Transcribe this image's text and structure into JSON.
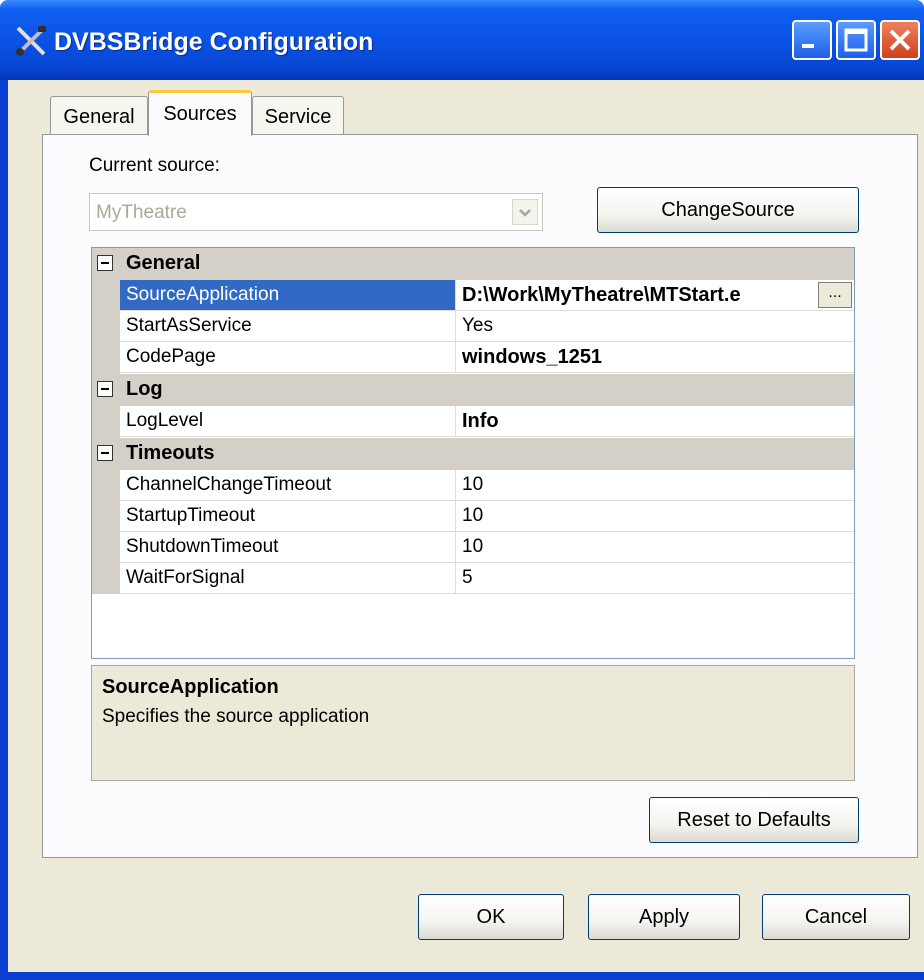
{
  "window": {
    "title": "DVBSBridge Configuration",
    "icons": {
      "app": "tools-icon",
      "minimize": "minimize-icon",
      "maximize": "maximize-icon",
      "close": "close-icon"
    }
  },
  "tabs": [
    {
      "label": "General",
      "active": false
    },
    {
      "label": "Sources",
      "active": true
    },
    {
      "label": "Service",
      "active": false
    }
  ],
  "sources": {
    "current_source_label": "Current source:",
    "current_source_value": "MyTheatre",
    "change_source_label": "ChangeSource"
  },
  "property_grid": {
    "categories": [
      {
        "name": "General",
        "properties": [
          {
            "name": "SourceApplication",
            "value": "D:\\Work\\MyTheatre\\MTStart.e",
            "bold": true,
            "selected": true
          },
          {
            "name": "StartAsService",
            "value": "Yes",
            "bold": false
          },
          {
            "name": "CodePage",
            "value": "windows_1251",
            "bold": true
          }
        ]
      },
      {
        "name": "Log",
        "properties": [
          {
            "name": "LogLevel",
            "value": "Info",
            "bold": true
          }
        ]
      },
      {
        "name": "Timeouts",
        "properties": [
          {
            "name": "ChannelChangeTimeout",
            "value": "10",
            "bold": false
          },
          {
            "name": "StartupTimeout",
            "value": "10",
            "bold": false
          },
          {
            "name": "ShutdownTimeout",
            "value": "10",
            "bold": false
          },
          {
            "name": "WaitForSignal",
            "value": "5",
            "bold": false
          }
        ]
      }
    ],
    "ellipsis_label": "..."
  },
  "description": {
    "title": "SourceApplication",
    "text": "Specifies the source application"
  },
  "buttons": {
    "reset": "Reset to Defaults",
    "ok": "OK",
    "apply": "Apply",
    "cancel": "Cancel"
  },
  "colors": {
    "titlebar": "#0a52e6",
    "selection": "#316ac5",
    "face": "#ece9d8",
    "category": "#d4d0c8"
  }
}
